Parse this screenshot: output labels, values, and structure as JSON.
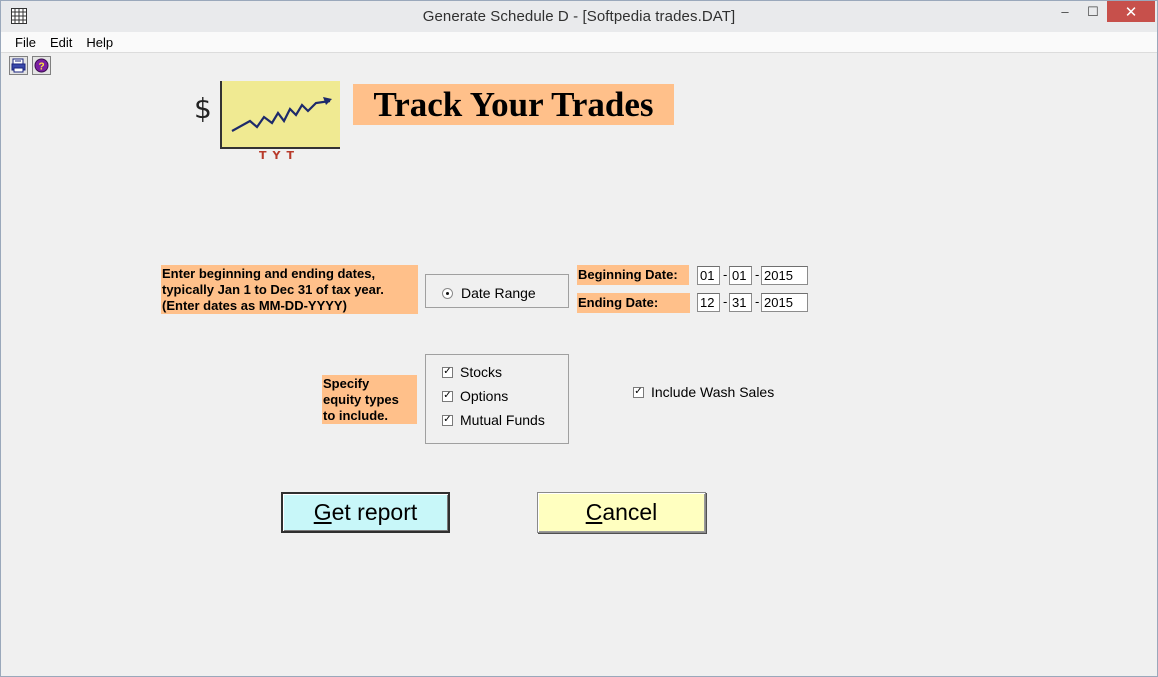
{
  "window": {
    "title": "Generate Schedule D - [Softpedia trades.DAT]",
    "minimize": "–",
    "maximize": "☐",
    "close": "✕"
  },
  "menu": [
    "File",
    "Edit",
    "Help"
  ],
  "toolbar": {
    "icons": [
      "print-icon",
      "help-icon"
    ]
  },
  "logo": {
    "dollar": "$",
    "ticks": "TYT"
  },
  "banner": "Track Your Trades",
  "dates_note": {
    "line1": "Enter beginning and ending dates,",
    "line2": "typically Jan 1 to Dec 31 of tax year.",
    "line3": "(Enter dates as MM-DD-YYYY)"
  },
  "date_range": {
    "label": "Date Range",
    "selected": true
  },
  "beginning": {
    "label": "Beginning Date:",
    "month": "01",
    "day": "01",
    "year": "2015"
  },
  "ending": {
    "label": "Ending Date:",
    "month": "12",
    "day": "31",
    "year": "2015"
  },
  "date_separator": "-",
  "equity_note": {
    "line1": "Specify",
    "line2": "equity types",
    "line3": "to include."
  },
  "equity_types": [
    {
      "label": "Stocks",
      "checked": true
    },
    {
      "label": "Options",
      "checked": true
    },
    {
      "label": "Mutual Funds",
      "checked": true
    }
  ],
  "wash_sales": {
    "label": "Include Wash Sales",
    "checked": true
  },
  "check_glyph": "✓",
  "buttons": {
    "get_report_first": "G",
    "get_report_rest": "et report",
    "cancel_first": "C",
    "cancel_rest": "ancel"
  },
  "colors": {
    "accent_orange": "#ffc08a",
    "logo_yellow": "#f0ea92",
    "get_report_bg": "#c8f7f9",
    "cancel_bg": "#ffffc0"
  }
}
